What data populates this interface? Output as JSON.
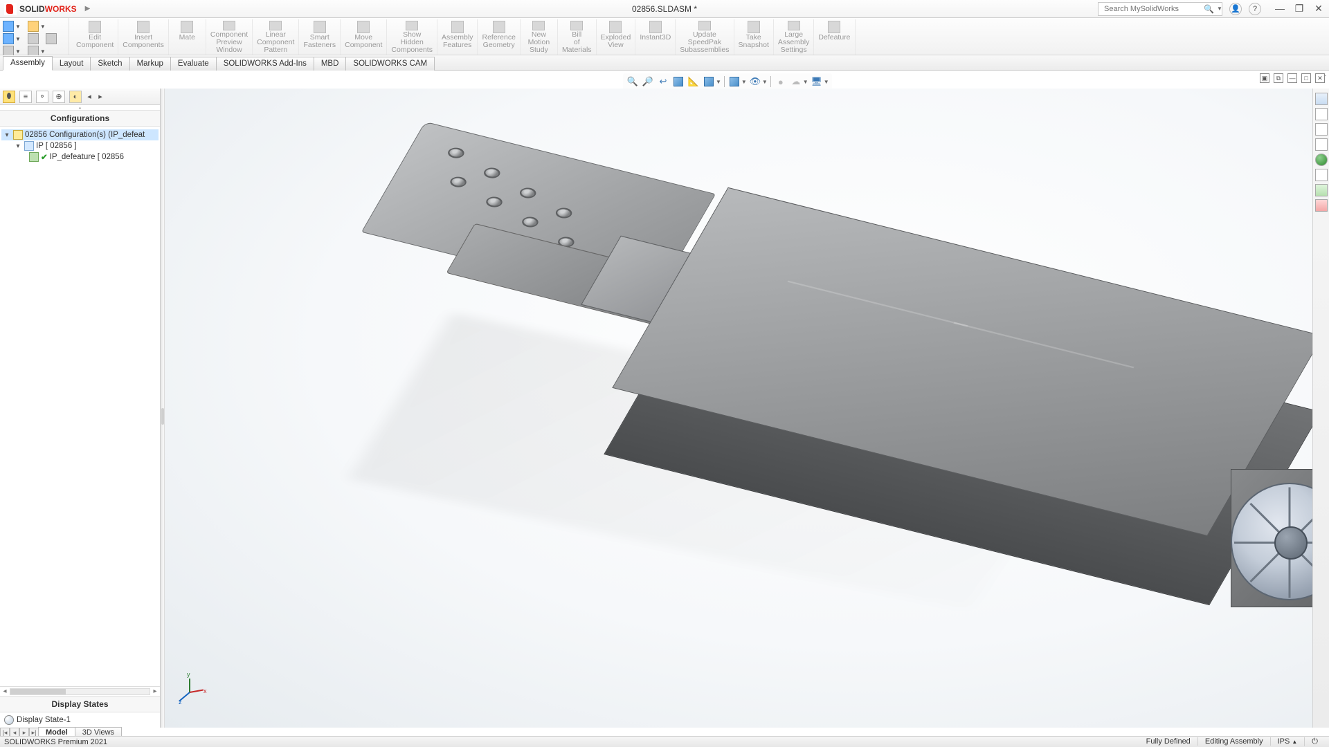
{
  "title": "02856.SLDASM *",
  "app_name_bold": "SOLID",
  "app_name_rest": "WORKS",
  "search": {
    "placeholder": "Search MySolidWorks"
  },
  "ribbon": [
    "Edit Component",
    "Insert Components",
    "Mate",
    "Component Preview Window",
    "Linear Component Pattern",
    "Smart Fasteners",
    "Move Component",
    "Show Hidden Components",
    "Assembly Features",
    "Reference Geometry",
    "New Motion Study",
    "Bill of Materials",
    "Exploded View",
    "Instant3D",
    "Update SpeedPak Subassemblies",
    "Take Snapshot",
    "Large Assembly Settings",
    "Defeature"
  ],
  "tabs": [
    "Assembly",
    "Layout",
    "Sketch",
    "Markup",
    "Evaluate",
    "SOLIDWORKS Add-Ins",
    "MBD",
    "SOLIDWORKS CAM"
  ],
  "active_tab": "Assembly",
  "left_panel": {
    "header": "Configurations",
    "root": "02856 Configuration(s)  (IP_defeat",
    "child": "IP [ 02856 ]",
    "leaf": "IP_defeature [ 02856",
    "display_header": "Display States",
    "display_item": "Display State-1"
  },
  "bottom_tabs": {
    "model": "Model",
    "views": "3D Views"
  },
  "status": {
    "left": "SOLIDWORKS Premium 2021",
    "defined": "Fully Defined",
    "mode": "Editing Assembly",
    "units": "IPS"
  },
  "triad": {
    "x": "x",
    "y": "y",
    "z": "z"
  }
}
